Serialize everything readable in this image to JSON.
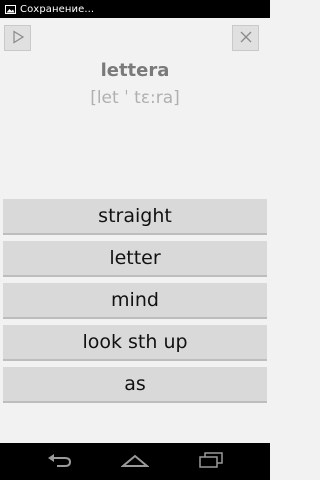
{
  "status_bar": {
    "notification_text": "Сохранение...",
    "notification_icon": "image-icon"
  },
  "toolbar": {
    "play_icon": "play-icon",
    "close_icon": "close-icon"
  },
  "card": {
    "word": "lettera",
    "transcription": "[let ˈ tɛ:ra]"
  },
  "options": [
    {
      "label": "straight"
    },
    {
      "label": "letter"
    },
    {
      "label": "mind"
    },
    {
      "label": "look sth up"
    },
    {
      "label": "as"
    }
  ],
  "nav": {
    "back_icon": "back-icon",
    "home_icon": "home-icon",
    "recent_icon": "recent-apps-icon"
  },
  "colors": {
    "option_bg": "#d9d9d9",
    "word_color": "#7a7a7a",
    "transcription_color": "#b0b0b0"
  }
}
